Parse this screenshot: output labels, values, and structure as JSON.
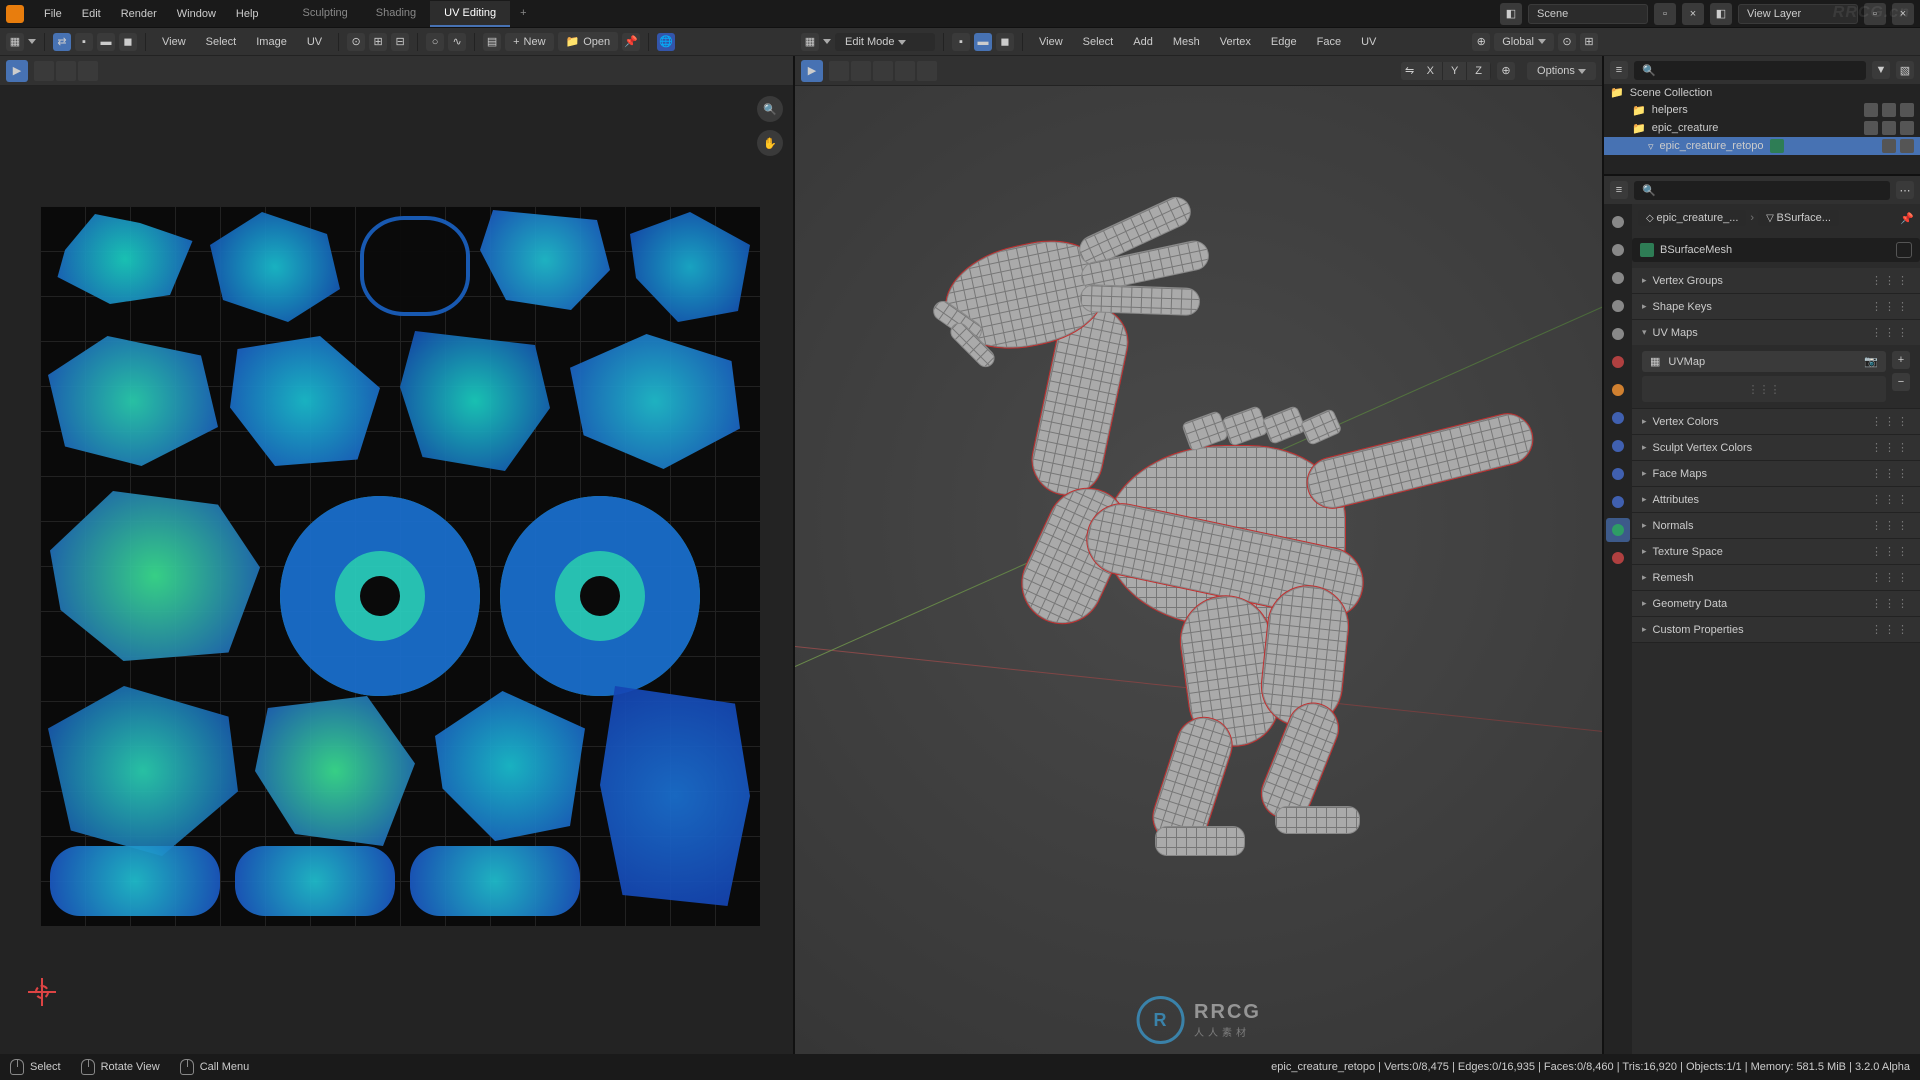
{
  "topmenu": {
    "file": "File",
    "edit": "Edit",
    "render": "Render",
    "window": "Window",
    "help": "Help"
  },
  "workspaces": {
    "sculpting": "Sculpting",
    "shading": "Shading",
    "uv": "UV Editing"
  },
  "scene_name": "Scene",
  "viewlayer_label": "View Layer",
  "watermark_tr": "RRCG.cn",
  "uv_header": {
    "view": "View",
    "select": "Select",
    "image": "Image",
    "uv": "UV",
    "new": "New",
    "open": "Open"
  },
  "vp_header": {
    "mode": "Edit Mode",
    "view": "View",
    "select": "Select",
    "add": "Add",
    "mesh": "Mesh",
    "vertex": "Vertex",
    "edge": "Edge",
    "face": "Face",
    "uv": "UV",
    "orient": "Global",
    "axis_x": "X",
    "axis_y": "Y",
    "axis_z": "Z",
    "options": "Options"
  },
  "outliner": {
    "root": "Scene Collection",
    "helpers": "helpers",
    "epic": "epic_creature",
    "retopo": "epic_creature_retopo"
  },
  "props": {
    "breadcrumb1": "epic_creature_...",
    "breadcrumb2": "BSurface...",
    "mesh_name": "BSurfaceMesh",
    "panels": {
      "vg": "Vertex Groups",
      "sk": "Shape Keys",
      "uvm": "UV Maps",
      "uvmap_name": "UVMap",
      "vc": "Vertex Colors",
      "svc": "Sculpt Vertex Colors",
      "fm": "Face Maps",
      "attr": "Attributes",
      "norm": "Normals",
      "tex": "Texture Space",
      "rem": "Remesh",
      "geo": "Geometry Data",
      "cp": "Custom Properties"
    }
  },
  "status": {
    "select": "Select",
    "rotate": "Rotate View",
    "call": "Call Menu",
    "info": "epic_creature_retopo | Verts:0/8,475 | Edges:0/16,935 | Faces:0/8,460 | Tris:16,920 | Objects:1/1 | Memory: 581.5 MiB | 3.2.0 Alpha"
  },
  "wm": {
    "big": "RRCG",
    "sub": "人人素材"
  }
}
